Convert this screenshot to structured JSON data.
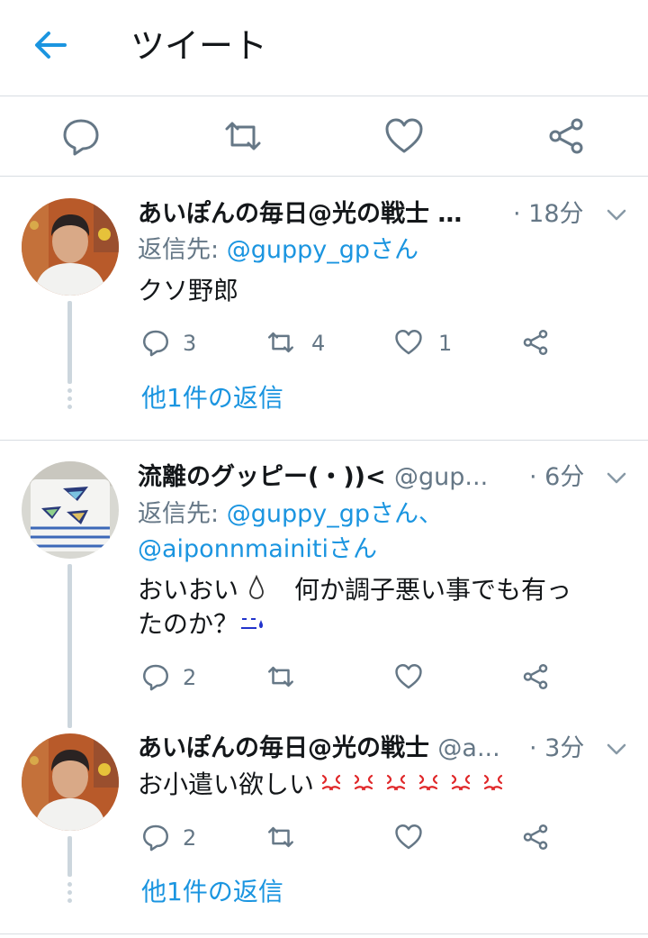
{
  "header": {
    "title": "ツイート"
  },
  "tweets": [
    {
      "name": "あいぽんの毎日@光の戦士 …",
      "handle": "",
      "time": "· 18分",
      "reply_prefix": "返信先: ",
      "reply_mention": "@guppy_gpさん",
      "reply_mention2": "",
      "text": "クソ野郎",
      "text2": "",
      "reply_count": "3",
      "retweet_count": "4",
      "like_count": "1",
      "more_replies": "他1件の返信"
    },
    {
      "name": "流離のグッピー(・))< ",
      "handle": "@gup...",
      "time": "· 6分",
      "reply_prefix": "返信先: ",
      "reply_mention": "@guppy_gpさん、",
      "reply_mention2": "@aiponnmainitiさん",
      "text": "おいおい",
      "text_b": "何か調子悪い事でも有っ",
      "text2": "たのか？",
      "reply_count": "2",
      "retweet_count": "",
      "like_count": ""
    },
    {
      "name": "あいぽんの毎日@光の戦士 ",
      "handle": "@a...",
      "time": "· 3分",
      "text": "お小遣い欲しい",
      "reply_count": "2",
      "retweet_count": "",
      "like_count": "",
      "more_replies": "他1件の返信"
    }
  ],
  "colors": {
    "accent": "#1b95e0",
    "icon": "#657786",
    "line": "#ccd6dd"
  }
}
